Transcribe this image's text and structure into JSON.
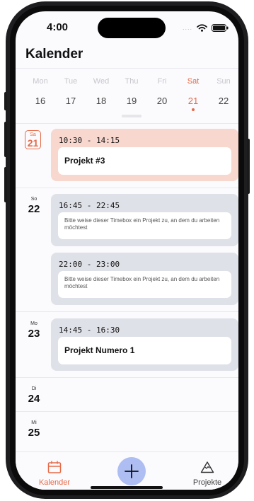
{
  "status_bar": {
    "time": "4:00",
    "signal": "....",
    "icons": [
      "wifi-icon",
      "battery-icon"
    ]
  },
  "app": {
    "title": "Kalender"
  },
  "week": [
    {
      "name": "Mon",
      "date": "16",
      "selected": false
    },
    {
      "name": "Tue",
      "date": "17",
      "selected": false
    },
    {
      "name": "Wed",
      "date": "18",
      "selected": false
    },
    {
      "name": "Thu",
      "date": "19",
      "selected": false
    },
    {
      "name": "Fri",
      "date": "20",
      "selected": false
    },
    {
      "name": "Sat",
      "date": "21",
      "selected": true
    },
    {
      "name": "Sun",
      "date": "22",
      "selected": false
    }
  ],
  "days": [
    {
      "weekday": "Sa",
      "date": "21",
      "today": true,
      "timeboxes": [
        {
          "range": "10:30 - 14:15",
          "project": "Projekt #3"
        }
      ]
    },
    {
      "weekday": "So",
      "date": "22",
      "timeboxes": [
        {
          "range": "16:45 - 22:45",
          "hint": "Bitte weise dieser Timebox ein Projekt zu, an dem du arbeiten möchtest"
        },
        {
          "range": "22:00 - 23:00",
          "hint": "Bitte weise dieser Timebox ein Projekt zu, an dem du arbeiten möchtest"
        }
      ]
    },
    {
      "weekday": "Mo",
      "date": "23",
      "timeboxes": [
        {
          "range": "14:45 - 16:30",
          "project": "Projekt Numero 1"
        }
      ]
    },
    {
      "weekday": "Di",
      "date": "24",
      "timeboxes": []
    },
    {
      "weekday": "Mi",
      "date": "25",
      "timeboxes": []
    }
  ],
  "tabbar": {
    "calendar_label": "Kalender",
    "projects_label": "Projekte",
    "add_icon": "plus-icon"
  },
  "colors": {
    "accent": "#e66a47",
    "active_box": "#f8d7cf",
    "box": "#dfe1e8",
    "fab": "#aebdf2"
  }
}
